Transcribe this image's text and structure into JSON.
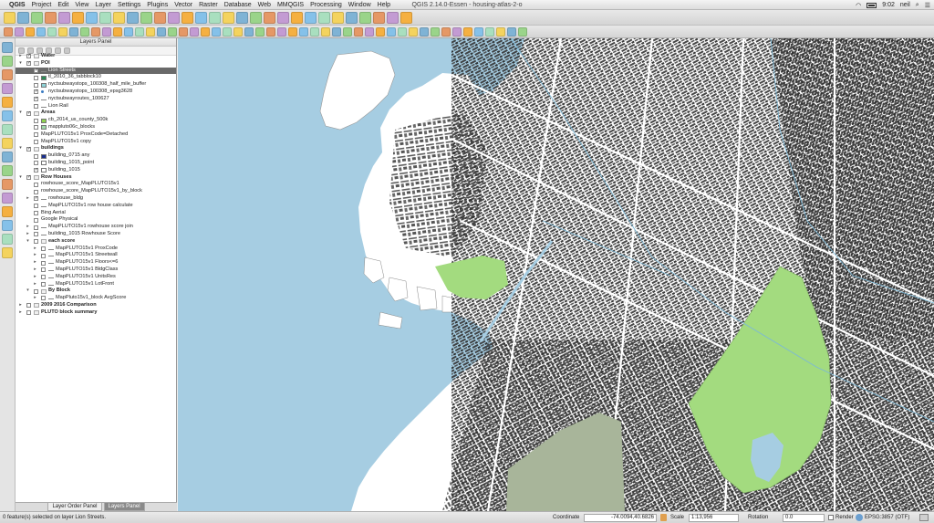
{
  "menubar": {
    "app": "QGIS",
    "items": [
      "Project",
      "Edit",
      "View",
      "Layer",
      "Settings",
      "Plugins",
      "Vector",
      "Raster",
      "Database",
      "Web",
      "MMQGIS",
      "Processing",
      "Window",
      "Help"
    ],
    "window_title": "QGIS 2.14.0-Essen - housing-atlas-2-o",
    "clock": "9:02",
    "user": "neil"
  },
  "layers_panel": {
    "title": "Layers Panel",
    "tabs": [
      "Layer Order Panel",
      "Layers Panel"
    ],
    "active_tab": 1,
    "rows": [
      {
        "label": "Water",
        "group": true,
        "indent": 0,
        "arrow": "▸",
        "checked": true
      },
      {
        "label": "POI",
        "group": true,
        "indent": 0,
        "arrow": "▾",
        "checked": true
      },
      {
        "label": "Lion Streets",
        "indent": 1,
        "checked": true,
        "selected": true,
        "swatch": "line"
      },
      {
        "label": "tl_2010_36_tabblock10",
        "indent": 1,
        "checked": false,
        "swatch": "#2e8b57"
      },
      {
        "label": "nyctsubwaystops_100308_half_mile_buffer",
        "indent": 1,
        "checked": false,
        "swatch": "#8ed4d8"
      },
      {
        "label": "nyctsubwaystops_100308_epsg3628",
        "indent": 1,
        "checked": true,
        "swatch": "dot"
      },
      {
        "label": "nyctsubwayroutes_100627",
        "indent": 1,
        "checked": true,
        "swatch": "line"
      },
      {
        "label": "Lion Rail",
        "indent": 1,
        "checked": false,
        "swatch": "line"
      },
      {
        "label": "Areas",
        "group": true,
        "indent": 0,
        "arrow": "▾",
        "checked": true
      },
      {
        "label": "cb_2014_us_county_500k",
        "indent": 1,
        "checked": false,
        "swatch": "#8fd14f"
      },
      {
        "label": "mappluto06c_blocks",
        "indent": 1,
        "checked": false,
        "swatch": "#9fd9a8"
      },
      {
        "label": "MapPLUTO15v1 ProxCode=Detached",
        "indent": 1,
        "checked": false,
        "swatch": "none"
      },
      {
        "label": "MapPLUTO15v1 copy",
        "indent": 1,
        "checked": false,
        "swatch": "none"
      },
      {
        "label": "buildings",
        "group": true,
        "indent": 0,
        "arrow": "▾",
        "checked": true
      },
      {
        "label": "building_0715 any",
        "indent": 1,
        "checked": false,
        "swatch": "#1a2f8f"
      },
      {
        "label": "building_1015_point",
        "indent": 1,
        "checked": false,
        "swatch": "#ffffff"
      },
      {
        "label": "building_1015",
        "indent": 1,
        "checked": true,
        "swatch": "#ffffff"
      },
      {
        "label": "Row Houses",
        "group": true,
        "indent": 0,
        "arrow": "▾",
        "checked": true
      },
      {
        "label": "rowhouse_score_MapPLUTO15v1",
        "indent": 1,
        "checked": false,
        "swatch": "none"
      },
      {
        "label": "rowhouse_score_MapPLUTO15v1_by_block",
        "indent": 1,
        "checked": false,
        "swatch": "none"
      },
      {
        "label": "rowhouse_bldg",
        "indent": 1,
        "arrow": "▸",
        "checked": true,
        "swatch": "line"
      },
      {
        "label": "MapPLUTO15v1 row house calculate",
        "indent": 1,
        "checked": false,
        "swatch": "line"
      },
      {
        "label": "Bing Aerial",
        "indent": 1,
        "checked": false,
        "swatch": "none"
      },
      {
        "label": "Google Physical",
        "indent": 1,
        "checked": false,
        "swatch": "none"
      },
      {
        "label": "MapPLUTO15v1 rowhouse score join",
        "indent": 1,
        "arrow": "▸",
        "checked": false,
        "swatch": "line"
      },
      {
        "label": "building_1015 Rowhouse Score",
        "indent": 1,
        "arrow": "▸",
        "checked": false,
        "swatch": "line"
      },
      {
        "label": "each score",
        "group": true,
        "indent": 1,
        "arrow": "▾",
        "checked": false
      },
      {
        "label": "MapPLUTO15v1 ProxCode",
        "indent": 2,
        "arrow": "▸",
        "checked": false,
        "swatch": "line"
      },
      {
        "label": "MapPLUTO15v1 Streetwall",
        "indent": 2,
        "arrow": "▸",
        "checked": false,
        "swatch": "line"
      },
      {
        "label": "MapPLUTO15v1 Floors<=6",
        "indent": 2,
        "arrow": "▸",
        "checked": false,
        "swatch": "line"
      },
      {
        "label": "MapPLUTO15v1 BldgClass",
        "indent": 2,
        "arrow": "▸",
        "checked": false,
        "swatch": "line"
      },
      {
        "label": "MapPLUTO15v1 UnitsRes",
        "indent": 2,
        "arrow": "▸",
        "checked": false,
        "swatch": "line"
      },
      {
        "label": "MapPLUTO15v1 LotFront",
        "indent": 2,
        "arrow": "▸",
        "checked": false,
        "swatch": "line"
      },
      {
        "label": "By Block",
        "group": true,
        "indent": 1,
        "arrow": "▾",
        "checked": false
      },
      {
        "label": "MapPluto15v1_block AvgScore",
        "indent": 2,
        "arrow": "▸",
        "checked": false,
        "swatch": "line"
      },
      {
        "label": "2009 2016 Comparison",
        "group": true,
        "indent": 0,
        "arrow": "▸",
        "checked": false
      },
      {
        "label": "PLUTO block summary",
        "group": true,
        "indent": 0,
        "arrow": "▸",
        "checked": false
      }
    ]
  },
  "map": {
    "water_color": "#a6cde2",
    "park_color": "#a3db7f",
    "cemetery_color": "#a8b59a",
    "land_color": "#ffffff",
    "building_color": "#2a2a2a"
  },
  "statusbar": {
    "message": "0 feature(s) selected on layer Lion Streets.",
    "coordinate_label": "Coordinate",
    "coordinate": "-74.0094,40.6826",
    "scale_label": "Scale",
    "scale": "1:13,956",
    "rotation_label": "Rotation",
    "rotation": "0.0",
    "render_label": "Render",
    "crs": "EPSG:3857 (OTF)"
  },
  "toolbar_icons": [
    "new-project",
    "open-project",
    "save-project",
    "save-as",
    "print-composer",
    "composer-manager",
    "pan",
    "pan-to-selection",
    "zoom-in",
    "zoom-out",
    "zoom-actual",
    "zoom-full",
    "zoom-to-selection",
    "zoom-to-layer",
    "zoom-last",
    "zoom-next",
    "refresh",
    "identify",
    "select",
    "deselect",
    "open-table",
    "measure",
    "statistics",
    "map-tips",
    "new-bookmark",
    "show-bookmarks",
    "text-annotation",
    "tile-scale",
    "python-console",
    "processing-toolbox"
  ]
}
